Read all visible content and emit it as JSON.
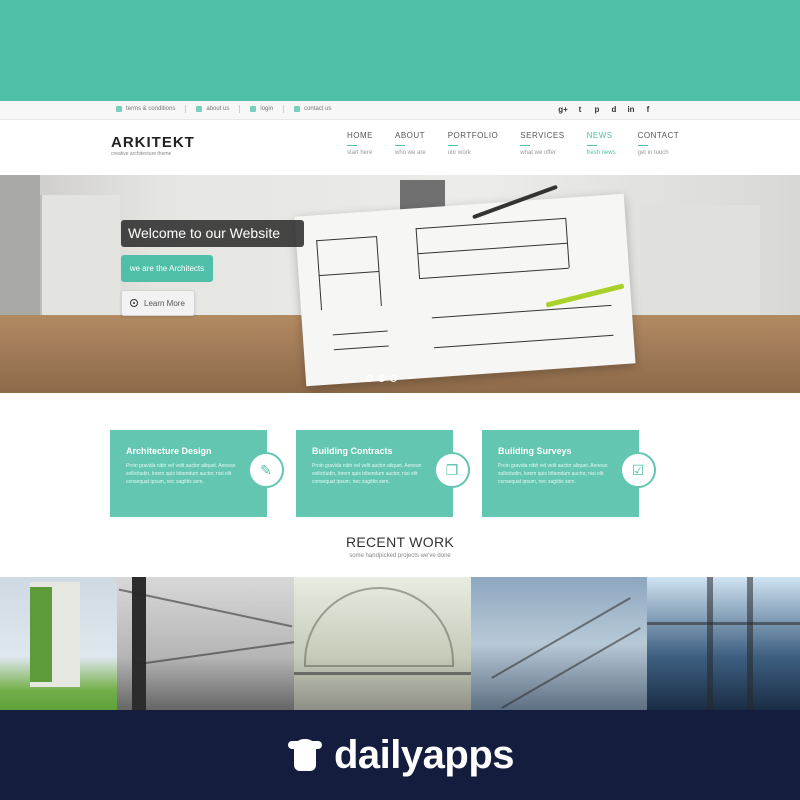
{
  "topbar": {
    "links": [
      {
        "label": "terms & conditions",
        "icon": "document-icon"
      },
      {
        "label": "about us",
        "icon": "info-icon"
      },
      {
        "label": "login",
        "icon": "lock-icon"
      },
      {
        "label": "contact us",
        "icon": "mail-icon"
      }
    ],
    "social": [
      "g+",
      "t",
      "p",
      "d",
      "in",
      "f"
    ]
  },
  "brand": {
    "title": "ARKITEKT",
    "subtitle": "creative architecture theme"
  },
  "nav": [
    {
      "label": "HOME",
      "sub": "start here"
    },
    {
      "label": "ABOUT",
      "sub": "who we are"
    },
    {
      "label": "PORTFOLIO",
      "sub": "our work"
    },
    {
      "label": "SERVICES",
      "sub": "what we offer"
    },
    {
      "label": "NEWS",
      "sub": "fresh news",
      "active": true
    },
    {
      "label": "CONTACT",
      "sub": "get in touch"
    }
  ],
  "hero": {
    "title": "Welcome to our Website",
    "subtitle": "we are the Architects",
    "button": "Learn More",
    "slides": 3,
    "active_slide": 2
  },
  "features": [
    {
      "title": "Architecture Design",
      "text": "Proin gravida nibh vel velit auctor aliquet. Aenean sollicitudin, lorem quis bibendum auctor, nisi elit consequat ipsum, nec sagittis sem.",
      "icon": "edit-icon"
    },
    {
      "title": "Building Contracts",
      "text": "Proin gravida nibh vel velit auctor aliquet. Aenean sollicitudin, lorem quis bibendum auctor, nisi elit consequat ipsum, nec sagittis sem.",
      "icon": "copy-icon"
    },
    {
      "title": "Building Surveys",
      "text": "Proin gravida nibh vel velit auctor aliquet. Aenean sollicitudin, lorem quis bibendum auctor, nisi elit consequat ipsum, nec sagittis sem.",
      "icon": "checkbox-icon"
    }
  ],
  "recent": {
    "title": "RECENT WORK",
    "subtitle": "some handpicked projects we've done"
  },
  "footer": {
    "brand": "dailyapps"
  },
  "colors": {
    "accent": "#4fbfa8",
    "footer": "#141d3d"
  }
}
